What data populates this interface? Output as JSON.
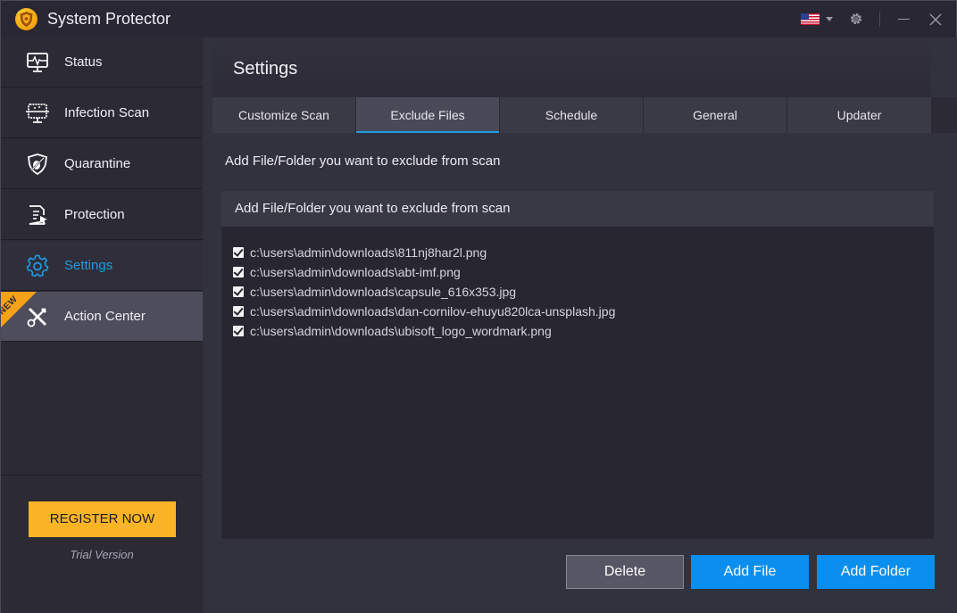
{
  "app": {
    "title": "System Protector",
    "language_icon": "us-flag-icon"
  },
  "sidebar": {
    "items": [
      {
        "label": "Status",
        "icon": "monitor-pulse-icon",
        "state": "normal"
      },
      {
        "label": "Infection Scan",
        "icon": "monitor-scan-icon",
        "state": "normal"
      },
      {
        "label": "Quarantine",
        "icon": "shield-bug-icon",
        "state": "normal"
      },
      {
        "label": "Protection",
        "icon": "document-cursor-icon",
        "state": "normal"
      },
      {
        "label": "Settings",
        "icon": "gear-icon",
        "state": "active"
      },
      {
        "label": "Action Center",
        "icon": "wrench-screwdriver-icon",
        "state": "highlight",
        "badge": "NEW"
      }
    ],
    "register_label": "REGISTER NOW",
    "trial_text": "Trial Version"
  },
  "main": {
    "page_title": "Settings",
    "tabs": [
      {
        "label": "Customize Scan",
        "active": false
      },
      {
        "label": "Exclude Files",
        "active": true
      },
      {
        "label": "Schedule",
        "active": false
      },
      {
        "label": "General",
        "active": false
      },
      {
        "label": "Updater",
        "active": false
      }
    ],
    "section_label": "Add File/Folder you want to exclude from scan",
    "list_header": "Add File/Folder you want to exclude from scan",
    "files": [
      {
        "path": "c:\\users\\admin\\downloads\\811nj8har2l.png",
        "checked": true
      },
      {
        "path": "c:\\users\\admin\\downloads\\abt-imf.png",
        "checked": true
      },
      {
        "path": "c:\\users\\admin\\downloads\\capsule_616x353.jpg",
        "checked": true
      },
      {
        "path": "c:\\users\\admin\\downloads\\dan-cornilov-ehuyu820lca-unsplash.jpg",
        "checked": true
      },
      {
        "path": "c:\\users\\admin\\downloads\\ubisoft_logo_wordmark.png",
        "checked": true
      }
    ],
    "buttons": {
      "delete": "Delete",
      "add_file": "Add File",
      "add_folder": "Add Folder"
    }
  },
  "colors": {
    "accent": "#1e9ce4",
    "primary_button": "#0a8fef",
    "register_button": "#fcb427",
    "new_badge": "#f5a11a"
  }
}
